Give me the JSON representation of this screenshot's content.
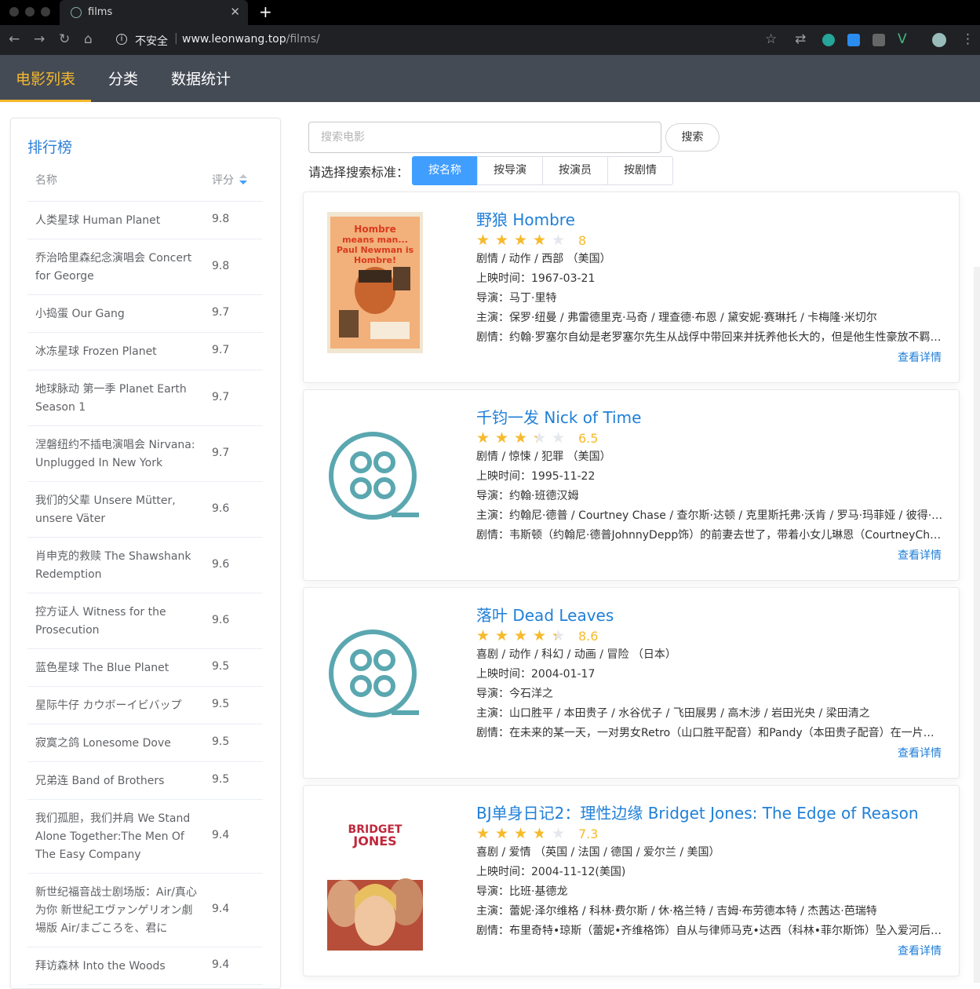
{
  "browser": {
    "tab_title": "films",
    "insecure_label": "不安全",
    "url_host": "www.leonwang.top",
    "url_path": "/films/"
  },
  "nav": {
    "items": [
      "电影列表",
      "分类",
      "数据统计"
    ],
    "active": 0,
    "accent": "#f5b82e"
  },
  "ranking": {
    "title": "排行榜",
    "col_name": "名称",
    "col_score": "评分",
    "rows": [
      {
        "name": "人类星球 Human Planet",
        "score": "9.8"
      },
      {
        "name": "乔治哈里森纪念演唱会 Concert for George",
        "score": "9.8"
      },
      {
        "name": "小捣蛋 Our Gang",
        "score": "9.7"
      },
      {
        "name": "冰冻星球 Frozen Planet",
        "score": "9.7"
      },
      {
        "name": "地球脉动 第一季 Planet Earth Season 1",
        "score": "9.7"
      },
      {
        "name": "涅磐纽约不插电演唱会 Nirvana: Unplugged In New York",
        "score": "9.7"
      },
      {
        "name": "我们的父辈 Unsere Mütter, unsere Väter",
        "score": "9.6"
      },
      {
        "name": "肖申克的救赎 The Shawshank Redemption",
        "score": "9.6"
      },
      {
        "name": "控方证人 Witness for the Prosecution",
        "score": "9.6"
      },
      {
        "name": "蓝色星球 The Blue Planet",
        "score": "9.5"
      },
      {
        "name": "星际牛仔 カウボーイビバップ",
        "score": "9.5"
      },
      {
        "name": "寂寞之鸽 Lonesome Dove",
        "score": "9.5"
      },
      {
        "name": "兄弟连 Band of Brothers",
        "score": "9.5"
      },
      {
        "name": "我们孤胆，我们并肩 We Stand Alone Together:The Men Of The Easy Company",
        "score": "9.4"
      },
      {
        "name": "新世纪福音战士剧场版：Air/真心为你 新世紀エヴァンゲリオン劇場版 Air/まごころを、君に",
        "score": "9.4"
      },
      {
        "name": "拜访森林 Into the Woods",
        "score": "9.4"
      }
    ]
  },
  "search": {
    "placeholder": "搜索电影",
    "button": "搜索",
    "criteria_label": "请选择搜索标准：",
    "criteria": [
      "按名称",
      "按导演",
      "按演员",
      "按剧情"
    ],
    "active": 0
  },
  "films": [
    {
      "title": "野狼 Hombre",
      "rating": 8,
      "rating_text": "8",
      "genre": "剧情 / 动作 / 西部 （美国）",
      "release": "上映时间：1967-03-21",
      "director": "导演：马丁·里特",
      "cast": "主演：保罗·纽曼 / 弗雷德里克·马奇 / 理查德·布恩 / 黛安妮·赛琳托 / 卡梅隆·米切尔",
      "plot": "剧情：约翰·罗塞尔自幼是老罗塞尔先生从战俘中带回来并抚养他长大的，但是他生性豪放不羁，经常",
      "more": "查看详情",
      "poster": "hombre",
      "poster_text": "Hombre means man... Paul Newman is Hombre!"
    },
    {
      "title": "千钧一发 Nick of Time",
      "rating": 6.5,
      "rating_text": "6.5",
      "genre": "剧情 / 惊悚 / 犯罪 （美国）",
      "release": "上映时间：1995-11-22",
      "director": "导演：约翰·班德汉姆",
      "cast": "主演：约翰尼·德普 / Courtney Chase / 查尔斯·达顿 / 克里斯托弗·沃肯 / 罗马·玛菲娅 / 彼得·斯特劳斯",
      "plot": "剧情：韦斯顿（约翰尼·德普JohnnyDepp饰）的前妻去世了，带着小女儿琳恩（CourtneyChase饰）",
      "more": "查看详情",
      "poster": "film-reel"
    },
    {
      "title": "落叶 Dead Leaves",
      "rating": 8.6,
      "rating_text": "8.6",
      "genre": "喜剧 / 动作 / 科幻 / 动画 / 冒险 （日本）",
      "release": "上映时间：2004-01-17",
      "director": "导演：今石洋之",
      "cast": "主演：山口胜平 / 本田贵子 / 水谷优子 / 飞田展男 / 高木涉 / 岩田光央 / 梁田清之",
      "plot": "剧情：在未来的某一天，一对男女Retro（山口胜平配音）和Pandy（本田贵子配音）在一片荒芜中醒来",
      "more": "查看详情",
      "poster": "film-reel"
    },
    {
      "title": "BJ单身日记2：理性边缘 Bridget Jones: The Edge of Reason",
      "rating": 7.3,
      "rating_text": "7.3",
      "genre": "喜剧 / 爱情 （英国 / 法国 / 德国 / 爱尔兰 / 美国）",
      "release": "上映时间：2004-11-12(美国)",
      "director": "导演：比班·基德龙",
      "cast": "主演：蕾妮·泽尔维格 / 科林·费尔斯 / 休·格兰特 / 吉姆·布劳德本特 / 杰茜达·芭瑞特",
      "plot": "剧情：布里奇特•琼斯（蕾妮•齐维格饰）自从与律师马克•达西（科林•菲尔斯饰）坠入爱河后，终于",
      "more": "查看详情",
      "poster": "bridget",
      "poster_text": "BRIDGET JONES"
    }
  ],
  "colors": {
    "link": "#1f7fd8",
    "star": "#f7ba2a",
    "star_empty": "#e4e7ed",
    "reel": "#5aa7b0"
  }
}
